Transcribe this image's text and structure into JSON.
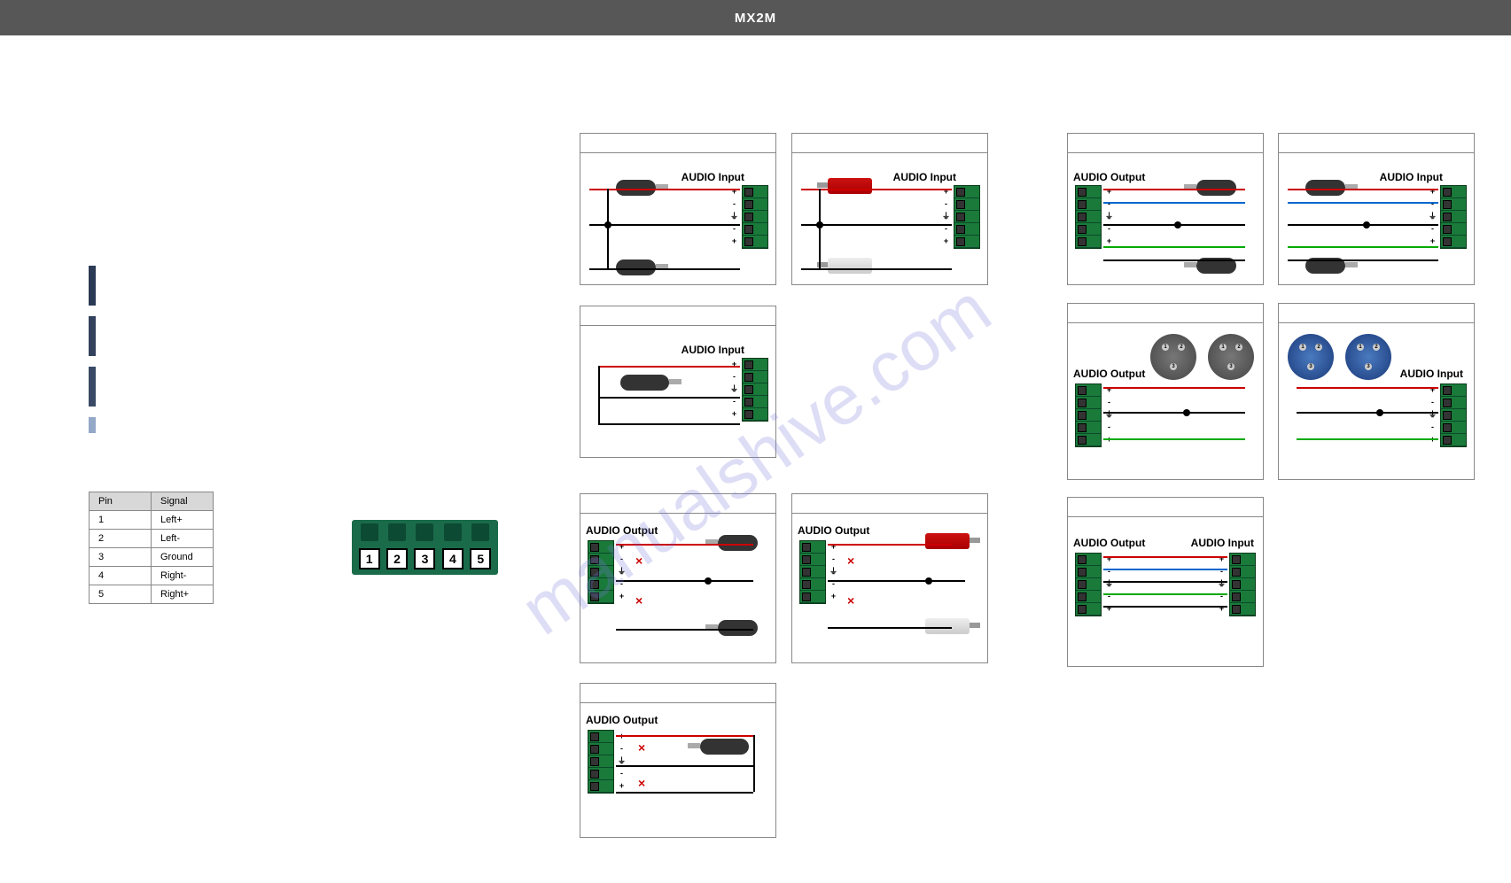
{
  "header": {
    "logo": "MX2M"
  },
  "watermark": "manualshive.com",
  "pin_table": {
    "headers": [
      "Pin",
      "Signal"
    ],
    "rows": [
      [
        "1",
        "Left+"
      ],
      [
        "2",
        "Left-"
      ],
      [
        "3",
        "Ground"
      ],
      [
        "4",
        "Right-"
      ],
      [
        "5",
        "Right+"
      ]
    ]
  },
  "phoenix": {
    "slots": [
      "1",
      "2",
      "3",
      "4",
      "5"
    ]
  },
  "diagrams": {
    "c1": {
      "label": "AUDIO Input"
    },
    "c2": {
      "label": "AUDIO Input"
    },
    "c3": {
      "label": "AUDIO Output"
    },
    "c4": {
      "label": "AUDIO Input"
    },
    "c5": {
      "label": "AUDIO Input"
    },
    "c6": {
      "label": "AUDIO Output"
    },
    "c7": {
      "label": "AUDIO Output"
    },
    "c8": {
      "label": "AUDIO Output"
    },
    "c9": {
      "label": "AUDIO Input"
    },
    "c10": {
      "label_out": "AUDIO Output",
      "label_in": "AUDIO Input"
    },
    "c11": {
      "label": "AUDIO Output"
    }
  },
  "signs5": "+\n-\n⏚\n-\n+",
  "xlr_pins": {
    "p1": "1",
    "p2": "2",
    "p3": "3"
  }
}
